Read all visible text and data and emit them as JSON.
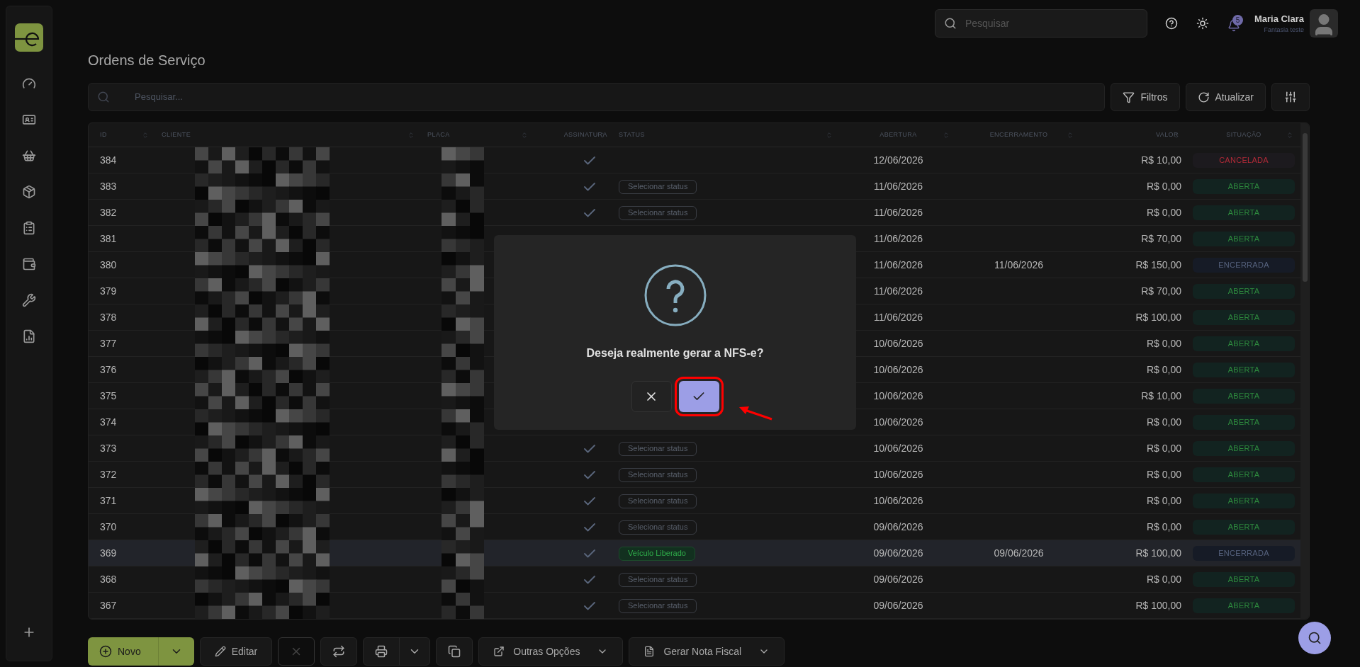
{
  "header": {
    "search_placeholder": "Pesquisar",
    "notifications": "5",
    "user_name": "Maria Clara",
    "user_subtitle": "Fantasia teste"
  },
  "page_title": "Ordens de Serviço",
  "filter_bar": {
    "search_placeholder": "Pesquisar...",
    "buttons": [
      {
        "label": "Filtros"
      },
      {
        "label": "Atualizar"
      }
    ]
  },
  "table": {
    "columns": [
      "ID",
      "CLIENTE",
      "PLACA",
      "ASSINATURA",
      "STATUS",
      "ABERTURA",
      "ENCERRAMENTO",
      "VALOR",
      "SITUAÇÃO"
    ],
    "rows": [
      {
        "id": "384",
        "signed": true,
        "status": null,
        "abertura": "12/06/2026",
        "encerramento": "",
        "valor": "R$ 10,00",
        "situacao": {
          "kind": "cancelada",
          "label": "CANCELADA"
        },
        "selected": false
      },
      {
        "id": "383",
        "signed": true,
        "status": {
          "kind": "select",
          "label": "Selecionar status"
        },
        "abertura": "11/06/2026",
        "encerramento": "",
        "valor": "R$ 0,00",
        "situacao": {
          "kind": "aberta",
          "label": "ABERTA"
        },
        "selected": false
      },
      {
        "id": "382",
        "signed": true,
        "status": {
          "kind": "select",
          "label": "Selecionar status"
        },
        "abertura": "11/06/2026",
        "encerramento": "",
        "valor": "R$ 0,00",
        "situacao": {
          "kind": "aberta",
          "label": "ABERTA"
        },
        "selected": false
      },
      {
        "id": "381",
        "status": null,
        "abertura": "11/06/2026",
        "encerramento": "",
        "valor": "R$ 70,00",
        "situacao": {
          "kind": "aberta",
          "label": "ABERTA"
        },
        "selected": false
      },
      {
        "id": "380",
        "status": null,
        "abertura": "11/06/2026",
        "encerramento": "11/06/2026",
        "valor": "R$ 150,00",
        "situacao": {
          "kind": "encerrada",
          "label": "ENCERRADA"
        },
        "selected": false
      },
      {
        "id": "379",
        "status": null,
        "abertura": "11/06/2026",
        "encerramento": "",
        "valor": "R$ 70,00",
        "situacao": {
          "kind": "aberta",
          "label": "ABERTA"
        },
        "selected": false
      },
      {
        "id": "378",
        "status": null,
        "abertura": "11/06/2026",
        "encerramento": "",
        "valor": "R$ 100,00",
        "situacao": {
          "kind": "aberta",
          "label": "ABERTA"
        },
        "selected": false
      },
      {
        "id": "377",
        "status": null,
        "abertura": "10/06/2026",
        "encerramento": "",
        "valor": "R$ 0,00",
        "situacao": {
          "kind": "aberta",
          "label": "ABERTA"
        },
        "selected": false
      },
      {
        "id": "376",
        "status": null,
        "abertura": "10/06/2026",
        "encerramento": "",
        "valor": "R$ 0,00",
        "situacao": {
          "kind": "aberta",
          "label": "ABERTA"
        },
        "selected": false
      },
      {
        "id": "375",
        "status": null,
        "abertura": "10/06/2026",
        "encerramento": "",
        "valor": "R$ 10,00",
        "situacao": {
          "kind": "aberta",
          "label": "ABERTA"
        },
        "selected": false
      },
      {
        "id": "374",
        "status": null,
        "abertura": "10/06/2026",
        "encerramento": "",
        "valor": "R$ 0,00",
        "situacao": {
          "kind": "aberta",
          "label": "ABERTA"
        },
        "selected": false
      },
      {
        "id": "373",
        "signed": true,
        "status": {
          "kind": "select",
          "label": "Selecionar status"
        },
        "abertura": "10/06/2026",
        "encerramento": "",
        "valor": "R$ 0,00",
        "situacao": {
          "kind": "aberta",
          "label": "ABERTA"
        },
        "selected": false
      },
      {
        "id": "372",
        "signed": true,
        "status": {
          "kind": "select",
          "label": "Selecionar status"
        },
        "abertura": "10/06/2026",
        "encerramento": "",
        "valor": "R$ 0,00",
        "situacao": {
          "kind": "aberta",
          "label": "ABERTA"
        },
        "selected": false
      },
      {
        "id": "371",
        "signed": true,
        "status": {
          "kind": "select",
          "label": "Selecionar status"
        },
        "abertura": "10/06/2026",
        "encerramento": "",
        "valor": "R$ 0,00",
        "situacao": {
          "kind": "aberta",
          "label": "ABERTA"
        },
        "selected": false
      },
      {
        "id": "370",
        "signed": true,
        "status": {
          "kind": "select",
          "label": "Selecionar status"
        },
        "abertura": "09/06/2026",
        "encerramento": "",
        "valor": "R$ 0,00",
        "situacao": {
          "kind": "aberta",
          "label": "ABERTA"
        },
        "selected": false
      },
      {
        "id": "369",
        "signed": true,
        "status": {
          "kind": "tag",
          "label": "Veículo Liberado"
        },
        "abertura": "09/06/2026",
        "encerramento": "09/06/2026",
        "valor": "R$ 100,00",
        "situacao": {
          "kind": "encerrada",
          "label": "ENCERRADA"
        },
        "selected": true
      },
      {
        "id": "368",
        "signed": true,
        "status": {
          "kind": "select",
          "label": "Selecionar status"
        },
        "abertura": "09/06/2026",
        "encerramento": "",
        "valor": "R$ 0,00",
        "situacao": {
          "kind": "aberta",
          "label": "ABERTA"
        },
        "selected": false
      },
      {
        "id": "367",
        "signed": true,
        "status": {
          "kind": "select",
          "label": "Selecionar status"
        },
        "abertura": "09/06/2026",
        "encerramento": "",
        "valor": "R$ 100,00",
        "situacao": {
          "kind": "aberta",
          "label": "ABERTA"
        },
        "selected": false
      }
    ]
  },
  "actions": [
    {
      "kind": "split-primary",
      "label": "Novo",
      "disabled": false
    },
    {
      "kind": "text",
      "label": "Editar",
      "disabled": false
    },
    {
      "kind": "icon",
      "disabled": true
    },
    {
      "kind": "icon",
      "disabled": false
    },
    {
      "kind": "split-icon",
      "disabled": false
    },
    {
      "kind": "icon",
      "disabled": false
    },
    {
      "kind": "menu",
      "label": "Outras Opções",
      "disabled": false
    },
    {
      "kind": "menu",
      "label": "Gerar Nota Fiscal",
      "disabled": false
    }
  ],
  "dialog": {
    "message": "Deseja realmente gerar a NFS-e?"
  }
}
